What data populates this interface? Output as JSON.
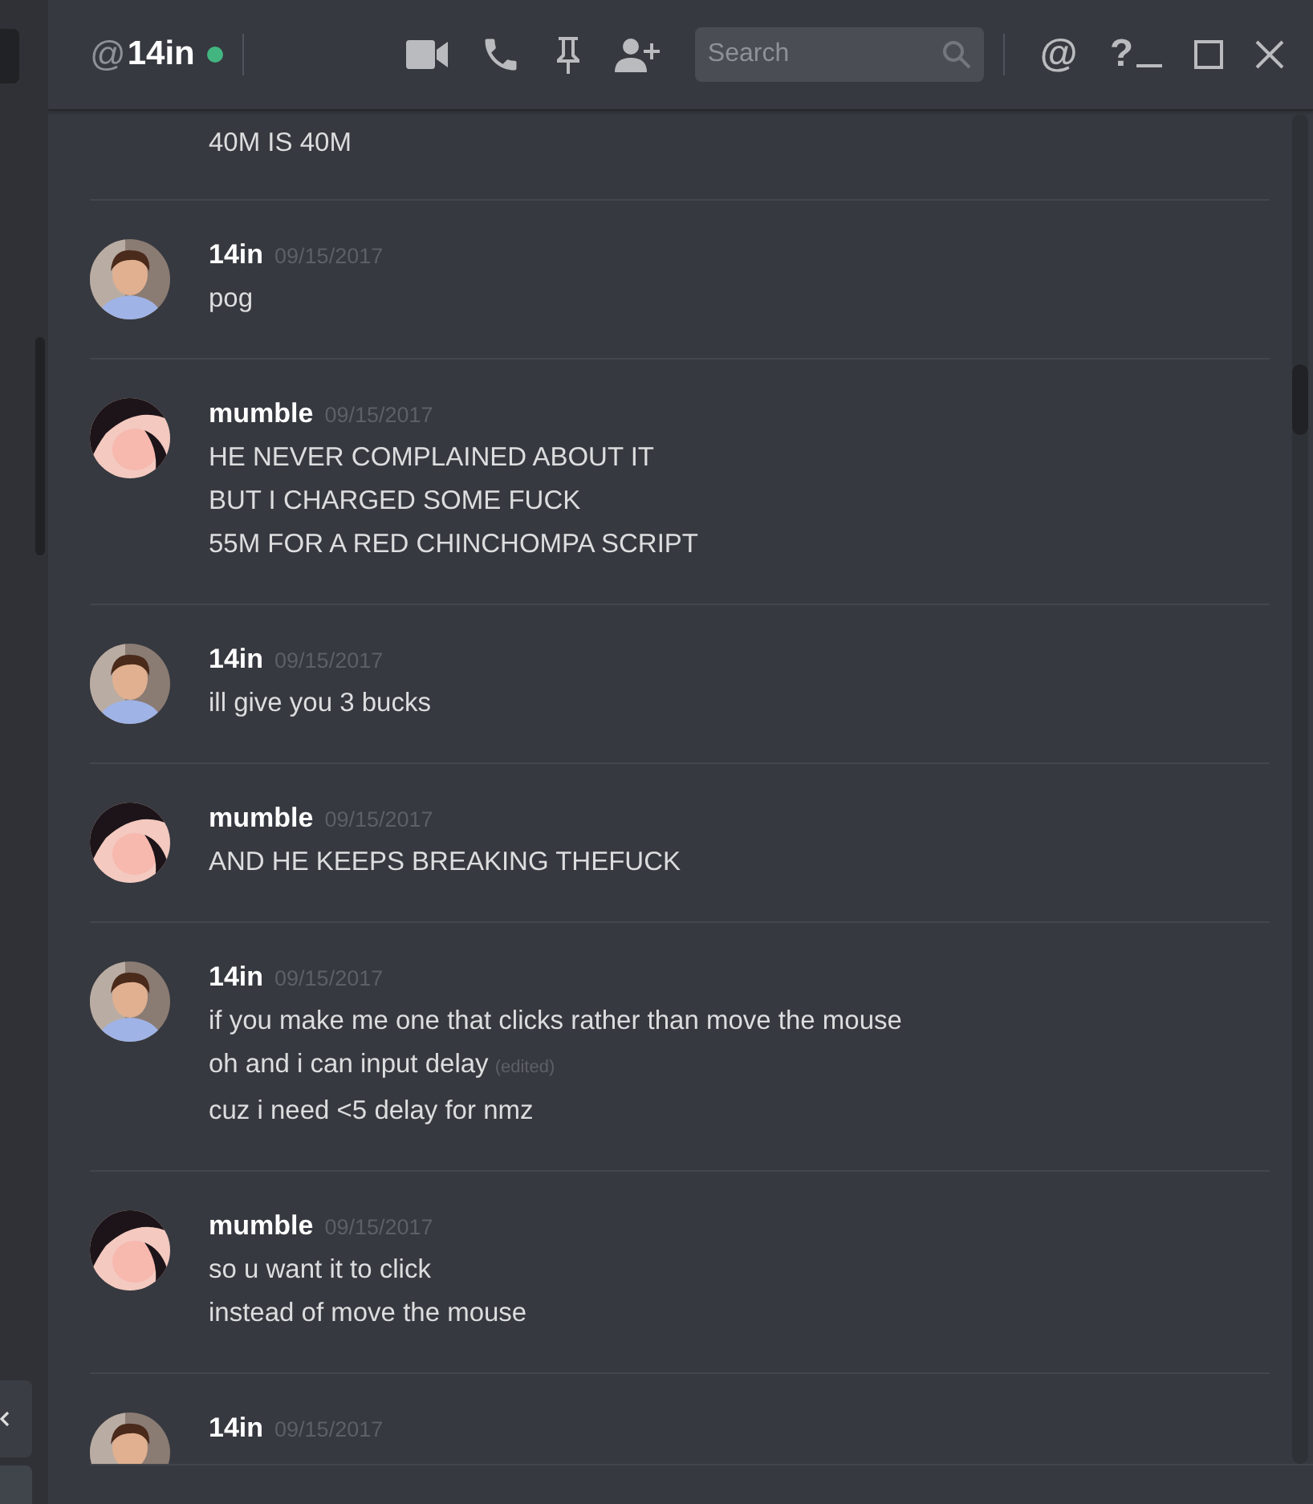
{
  "header": {
    "at_sign": "@",
    "username": "14in",
    "online": true,
    "search": {
      "placeholder": "Search"
    },
    "mentions_glyph": "@",
    "help_glyph": "?"
  },
  "partial_message": {
    "lines": [
      "40M IS 40M"
    ]
  },
  "messages": [
    {
      "author": "14in",
      "avatar": {
        "kind": "photo"
      },
      "date": "09/15/2017",
      "lines": [
        {
          "text": "pog"
        }
      ]
    },
    {
      "author": "mumble",
      "avatar": {
        "kind": "cartoon"
      },
      "date": "09/15/2017",
      "lines": [
        {
          "text": "HE NEVER COMPLAINED ABOUT IT"
        },
        {
          "text": "BUT I CHARGED SOME FUCK"
        },
        {
          "text": "55M FOR A RED CHINCHOMPA SCRIPT"
        }
      ]
    },
    {
      "author": "14in",
      "avatar": {
        "kind": "photo"
      },
      "date": "09/15/2017",
      "lines": [
        {
          "text": "ill give you 3 bucks"
        }
      ]
    },
    {
      "author": "mumble",
      "avatar": {
        "kind": "cartoon"
      },
      "date": "09/15/2017",
      "lines": [
        {
          "text": "AND HE KEEPS BREAKING THEFUCK"
        }
      ]
    },
    {
      "author": "14in",
      "avatar": {
        "kind": "photo"
      },
      "date": "09/15/2017",
      "lines": [
        {
          "text": "if you make me one that clicks rather than move the mouse"
        },
        {
          "text": "oh and i can input delay",
          "note": "(edited)"
        },
        {
          "text": "cuz i need <5 delay for nmz"
        }
      ]
    },
    {
      "author": "mumble",
      "avatar": {
        "kind": "cartoon"
      },
      "date": "09/15/2017",
      "lines": [
        {
          "text": "so u want it to click"
        },
        {
          "text": "instead of move the mouse"
        }
      ]
    },
    {
      "author": "14in",
      "avatar": {
        "kind": "photo"
      },
      "date": "09/15/2017"
    }
  ]
}
